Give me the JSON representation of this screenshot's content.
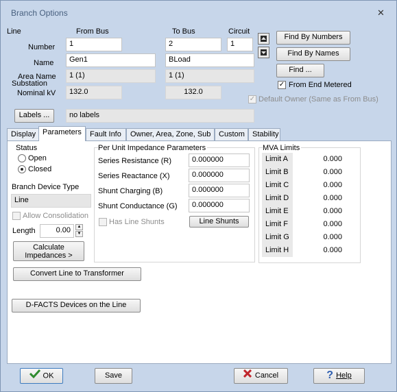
{
  "window": {
    "title": "Branch Options",
    "close_glyph": "✕"
  },
  "header": {
    "line_label": "Line",
    "from_bus_label": "From Bus",
    "to_bus_label": "To Bus",
    "circuit_label": "Circuit",
    "number_label": "Number",
    "name_label": "Name",
    "area_name_label": "Area Name",
    "substation_label": "Substation",
    "nominal_kv_label": "Nominal kV",
    "from_number": "1",
    "to_number": "2",
    "circuit": "1",
    "from_name": "Gen1",
    "to_name": "BLoad",
    "from_area": "1 (1)",
    "to_area": "1 (1)",
    "from_kv": "132.0",
    "to_kv": "132.0",
    "labels_button": "Labels ...",
    "labels_value": "no labels",
    "find_by_numbers": "Find By Numbers",
    "find_by_names": "Find By Names",
    "find": "Find ...",
    "from_end_metered": "From End Metered",
    "default_owner": "Default Owner (Same as From Bus)",
    "nav_up_icon": "up-arrow-icon",
    "nav_down_icon": "down-arrow-icon"
  },
  "tabs": [
    {
      "label": "Display",
      "active": false
    },
    {
      "label": "Parameters",
      "active": true
    },
    {
      "label": "Fault Info",
      "active": false
    },
    {
      "label": "Owner, Area, Zone, Sub",
      "active": false
    },
    {
      "label": "Custom",
      "active": false
    },
    {
      "label": "Stability",
      "active": false
    }
  ],
  "status": {
    "title": "Status",
    "open_label": "Open",
    "closed_label": "Closed",
    "selected": "Closed"
  },
  "device": {
    "type_label": "Branch Device Type",
    "type_value": "Line",
    "allow_consolidation": "Allow Consolidation",
    "length_label": "Length",
    "length_value": "0.00",
    "calc_line1": "Calculate",
    "calc_line2": "Impedances >",
    "convert_button": "Convert Line to Transformer",
    "dfacts_button": "D-FACTS Devices on the Line"
  },
  "impedance": {
    "title": "Per Unit Impedance Parameters",
    "rows": [
      {
        "label": "Series Resistance (R)",
        "value": "0.000000"
      },
      {
        "label": "Series Reactance (X)",
        "value": "0.000000"
      },
      {
        "label": "Shunt Charging (B)",
        "value": "0.000000"
      },
      {
        "label": "Shunt Conductance (G)",
        "value": "0.000000"
      }
    ],
    "has_line_shunts": "Has Line Shunts",
    "line_shunts_button": "Line Shunts"
  },
  "mva": {
    "title": "MVA Limits",
    "rows": [
      {
        "label": "Limit A",
        "value": "0.000"
      },
      {
        "label": "Limit B",
        "value": "0.000"
      },
      {
        "label": "Limit C",
        "value": "0.000"
      },
      {
        "label": "Limit D",
        "value": "0.000"
      },
      {
        "label": "Limit E",
        "value": "0.000"
      },
      {
        "label": "Limit F",
        "value": "0.000"
      },
      {
        "label": "Limit G",
        "value": "0.000"
      },
      {
        "label": "Limit H",
        "value": "0.000"
      }
    ]
  },
  "footer": {
    "ok": "OK",
    "save": "Save",
    "cancel": "Cancel",
    "help": "Help",
    "ok_icon": "checkmark-icon",
    "cancel_icon": "x-icon",
    "help_icon": "question-mark-icon"
  },
  "colors": {
    "window_bg": "#c7d6ea",
    "ok_check": "#2e8b2e",
    "cancel_x": "#c0262c",
    "help_q": "#2f5fb0"
  }
}
